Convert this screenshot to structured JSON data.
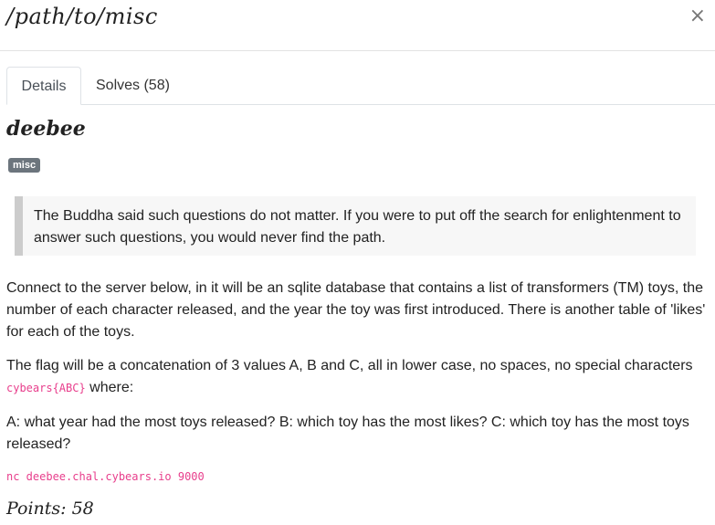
{
  "header": {
    "title": "/path/to/misc",
    "close_label": "×"
  },
  "tabs": [
    {
      "label": "Details",
      "active": true
    },
    {
      "label": "Solves (58)",
      "active": false
    }
  ],
  "challenge": {
    "name": "deebee",
    "category_badge": "misc",
    "quote": "The Buddha said such questions do not matter. If you were to put off the search for enlightenment to answer such questions, you would never find the path.",
    "description_1": "Connect to the server below, in it will be an sqlite database that contains a list of transformers (TM) toys, the number of each character released, and the year the toy was first introduced. There is another table of 'likes' for each of the toys.",
    "description_2_text": "The flag will be a concatenation of 3 values A, B and C, all in lower case, no spaces, no special characters",
    "description_2_code": "cybears{ABC}",
    "description_2_suffix": " where:",
    "description_3": "A: what year had the most toys released? B: which toy has the most likes? C: which toy has the most toys released?",
    "connection": "nc deebee.chal.cybears.io 9000",
    "points": "Points: 58"
  },
  "colors": {
    "badge_bg": "#6c757d",
    "code_text": "#e83e8c",
    "quote_border": "#cccccc",
    "quote_bg": "#f7f7f7"
  }
}
